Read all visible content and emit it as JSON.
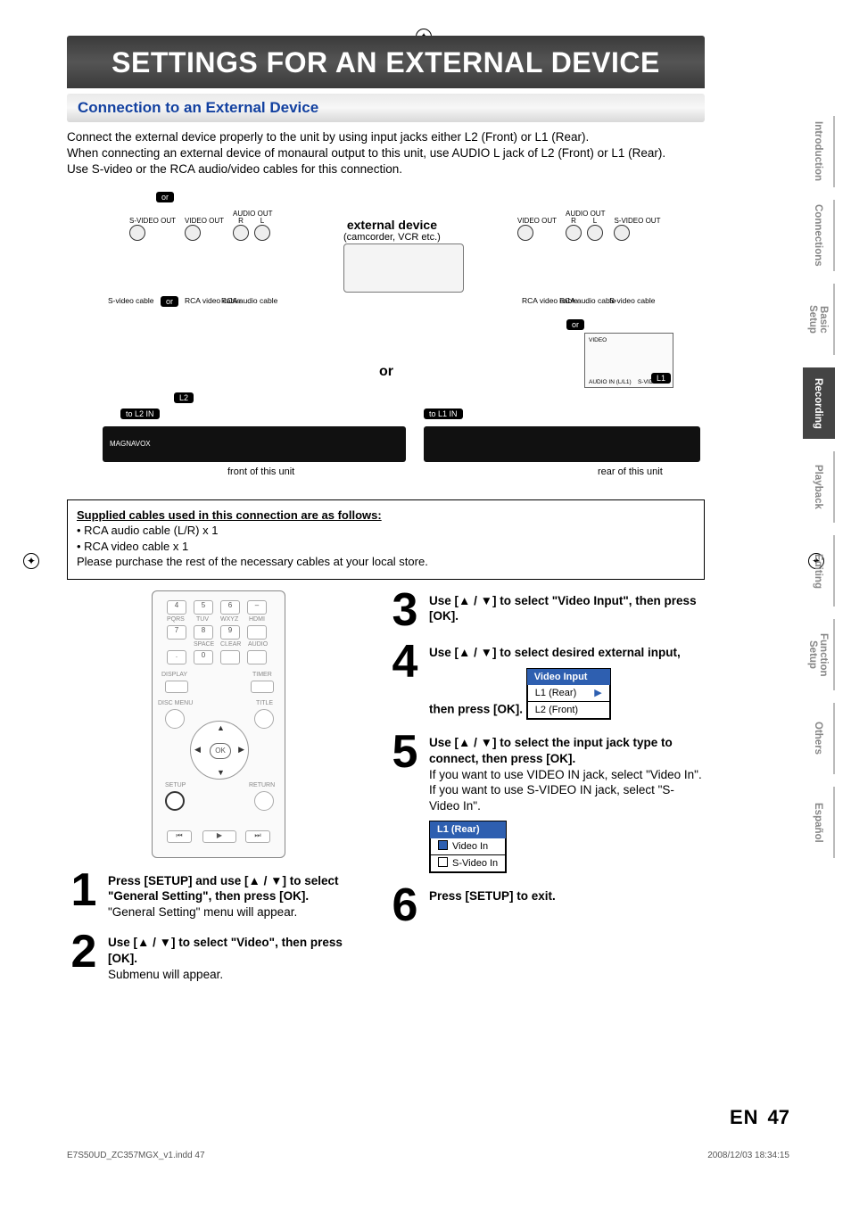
{
  "title": "SETTINGS FOR AN EXTERNAL DEVICE",
  "subhead": "Connection to an External Device",
  "intro1": "Connect the external device properly to the unit by using input jacks either L2 (Front) or L1 (Rear).",
  "intro2": "When connecting an external device of monaural output to this unit, use AUDIO L jack of L2 (Front) or L1 (Rear).",
  "intro3": "Use S-video or the RCA audio/video cables for this connection.",
  "diagram": {
    "ext_bold": "external device",
    "ext_sub": "(camcorder, VCR etc.)",
    "or": "or",
    "front_cap": "front of this unit",
    "rear_cap": "rear of this unit",
    "to_l2": "to L2 IN",
    "to_l1": "to L1 IN",
    "l1": "L1",
    "l2": "L2",
    "svideo_out": "S-VIDEO OUT",
    "video_out": "VIDEO OUT",
    "audio_out": "AUDIO OUT",
    "audio_r": "R",
    "audio_l": "L",
    "svideo_cable": "S-video cable",
    "rca_video": "RCA video cable",
    "rca_audio": "RCA audio cable",
    "rear_video": "VIDEO",
    "rear_audio_in": "AUDIO IN (L/L1)",
    "rear_svideo_in": "S-VIDEO IN"
  },
  "supplied": {
    "title": "Supplied cables used in this connection are as follows:",
    "b1": "• RCA audio cable (L/R) x 1",
    "b2": "• RCA video cable x 1",
    "note": "Please purchase the rest of the necessary cables at your local store."
  },
  "remote": {
    "k4": "4",
    "k5": "5",
    "k6": "6",
    "kdash": "–",
    "k7": "7",
    "k8": "8",
    "k9": "9",
    "kdot": ".",
    "k0": "0",
    "pqrs": "PQRS",
    "tuv": "TUV",
    "wxyz": "WXYZ",
    "hdmi": "HDMI",
    "space": "SPACE",
    "clear": "CLEAR",
    "audio": "AUDIO",
    "display": "DISPLAY",
    "timer": "TIMER",
    "disc_menu": "DISC MENU",
    "title": "TITLE",
    "setup": "SETUP",
    "return": "RETURN",
    "ok": "OK"
  },
  "steps": {
    "s1": {
      "num": "1",
      "bold": "Press [SETUP] and use [▲ / ▼] to select \"General Setting\", then press [OK].",
      "sub": "\"General Setting\" menu will appear."
    },
    "s2": {
      "num": "2",
      "bold": "Use [▲ / ▼] to select \"Video\", then press [OK].",
      "sub": "Submenu will appear."
    },
    "s3": {
      "num": "3",
      "bold": "Use [▲ / ▼] to select \"Video Input\", then press [OK]."
    },
    "s4": {
      "num": "4",
      "bold": "Use [▲ / ▼] to select desired external input, then press [OK]."
    },
    "s5": {
      "num": "5",
      "bold": "Use [▲ / ▼] to select the input jack type to connect, then press [OK].",
      "sub1": "If you want to use VIDEO IN jack, select \"Video In\".",
      "sub2": " If you want to use S-VIDEO IN jack, select \"S-Video In\"."
    },
    "s6": {
      "num": "6",
      "bold": "Press [SETUP] to exit."
    }
  },
  "menus": {
    "video_input_hdr": "Video Input",
    "l1_rear": "L1 (Rear)",
    "l2_front": "L2 (Front)",
    "video_in": "Video In",
    "s_video_in": "S-Video In"
  },
  "tabs": {
    "intro": "Introduction",
    "conn": "Connections",
    "basic": "Basic Setup",
    "rec": "Recording",
    "play": "Playback",
    "edit": "Editing",
    "func": "Function Setup",
    "others": "Others",
    "esp": "Español"
  },
  "footer": {
    "en": "EN",
    "page": "47"
  },
  "fine": {
    "left": "E7S50UD_ZC357MGX_v1.indd   47",
    "right": "2008/12/03   18:34:15"
  }
}
